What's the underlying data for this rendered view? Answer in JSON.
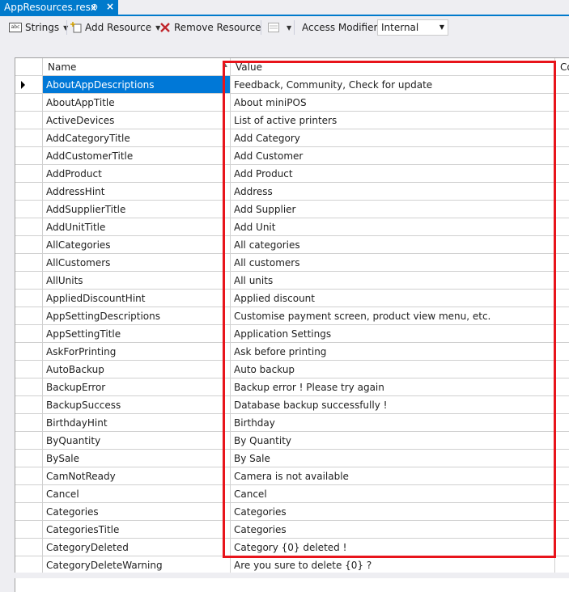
{
  "tab": {
    "title": "AppResources.resx",
    "pin": "⊕",
    "close": "×"
  },
  "toolbar": {
    "strings_label": "Strings",
    "add_label": "Add Resource",
    "remove_label": "Remove Resource",
    "access_label": "Access Modifier:",
    "access_value": "Internal"
  },
  "grid": {
    "columns": [
      "Name",
      "Value",
      "Co"
    ],
    "rows": [
      {
        "name": "AboutAppDescriptions",
        "value": "Feedback, Community, Check for update"
      },
      {
        "name": "AboutAppTitle",
        "value": "About miniPOS"
      },
      {
        "name": "ActiveDevices",
        "value": "List of active printers"
      },
      {
        "name": "AddCategoryTitle",
        "value": "Add Category"
      },
      {
        "name": "AddCustomerTitle",
        "value": "Add Customer"
      },
      {
        "name": "AddProduct",
        "value": "Add Product"
      },
      {
        "name": "AddressHint",
        "value": "Address"
      },
      {
        "name": "AddSupplierTitle",
        "value": "Add Supplier"
      },
      {
        "name": "AddUnitTitle",
        "value": "Add Unit"
      },
      {
        "name": "AllCategories",
        "value": "All categories"
      },
      {
        "name": "AllCustomers",
        "value": "All customers"
      },
      {
        "name": "AllUnits",
        "value": "All units"
      },
      {
        "name": "AppliedDiscountHint",
        "value": "Applied discount"
      },
      {
        "name": "AppSettingDescriptions",
        "value": "Customise payment screen, product view menu, etc."
      },
      {
        "name": "AppSettingTitle",
        "value": "Application Settings"
      },
      {
        "name": "AskForPrinting",
        "value": "Ask before printing"
      },
      {
        "name": "AutoBackup",
        "value": "Auto backup"
      },
      {
        "name": "BackupError",
        "value": "Backup error ! Please try again"
      },
      {
        "name": "BackupSuccess",
        "value": "Database backup successfully !"
      },
      {
        "name": "BirthdayHint",
        "value": "Birthday"
      },
      {
        "name": "ByQuantity",
        "value": "By Quantity"
      },
      {
        "name": "BySale",
        "value": "By Sale"
      },
      {
        "name": "CamNotReady",
        "value": "Camera is not available"
      },
      {
        "name": "Cancel",
        "value": "Cancel"
      },
      {
        "name": "Categories",
        "value": "Categories"
      },
      {
        "name": "CategoriesTitle",
        "value": "Categories"
      },
      {
        "name": "CategoryDeleted",
        "value": "Category {0} deleted !"
      },
      {
        "name": "CategoryDeleteWarning",
        "value": "Are you sure to delete  {0}  ?"
      }
    ]
  },
  "colors": {
    "accent": "#007acc",
    "selection": "#0078d7",
    "highlight_box": "#e8141b"
  }
}
